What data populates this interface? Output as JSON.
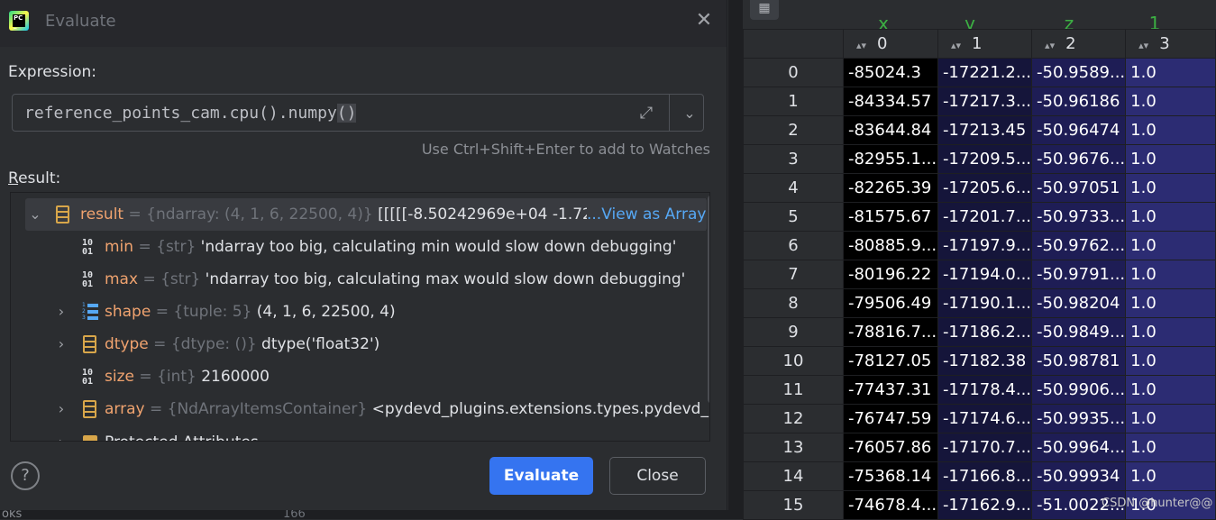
{
  "dialog": {
    "title": "Evaluate",
    "expression_label": "Expression:",
    "expression_main": "reference_points_cam.cpu().numpy",
    "expression_paren": "()",
    "hint": "Use Ctrl+Shift+Enter to add to Watches",
    "result_label_first": "R",
    "result_label_rest": "esult:",
    "evaluate_button": "Evaluate",
    "close_button": "Close",
    "help": "?"
  },
  "tree": [
    {
      "name": "result",
      "eq": " = ",
      "type": "{ndarray: (4, 1, 6, 22500, 4)}",
      "value": " [[[[[-8.50242969e+04 -1.722",
      "link": "...View as Array",
      "icon": "array-icon",
      "expandable": true,
      "expanded": true
    },
    {
      "name": "min",
      "eq": " = ",
      "type": "{str}",
      "value": " 'ndarray too big, calculating min would slow down debugging'",
      "icon": "binary-icon"
    },
    {
      "name": "max",
      "eq": " = ",
      "type": "{str}",
      "value": " 'ndarray too big, calculating max would slow down debugging'",
      "icon": "binary-icon"
    },
    {
      "name": "shape",
      "eq": " = ",
      "type": "{tuple: 5}",
      "value": " (4, 1, 6, 22500, 4)",
      "icon": "list-icon",
      "expandable": true
    },
    {
      "name": "dtype",
      "eq": " = ",
      "type": "{dtype: ()}",
      "value": " dtype('float32')",
      "icon": "array-icon",
      "expandable": true
    },
    {
      "name": "size",
      "eq": " = ",
      "type": "{int}",
      "value": " 2160000",
      "icon": "binary-icon"
    },
    {
      "name": "array",
      "eq": " = ",
      "type": "{NdArrayItemsContainer}",
      "value": " <pydevd_plugins.extensions.types.pydevd_",
      "icon": "array-icon",
      "expandable": true
    },
    {
      "name": "Protected Attributes",
      "eq": "",
      "type": "",
      "value": "",
      "icon": "folder-icon",
      "expandable": true
    }
  ],
  "bottom_strip": {
    "left_text": "oks",
    "mid_text": "166"
  },
  "data_view": {
    "axis_labels": [
      "x",
      "y",
      "z",
      "1"
    ],
    "columns": [
      "0",
      "1",
      "2",
      "3"
    ],
    "rows": [
      [
        "0",
        "-85024.3",
        "-17221.2...",
        "-50.9589...",
        "1.0"
      ],
      [
        "1",
        "-84334.57",
        "-17217.3...",
        "-50.96186",
        "1.0"
      ],
      [
        "2",
        "-83644.84",
        "-17213.45",
        "-50.96474",
        "1.0"
      ],
      [
        "3",
        "-82955.1...",
        "-17209.5...",
        "-50.9676...",
        "1.0"
      ],
      [
        "4",
        "-82265.39",
        "-17205.6...",
        "-50.97051",
        "1.0"
      ],
      [
        "5",
        "-81575.67",
        "-17201.7...",
        "-50.9733...",
        "1.0"
      ],
      [
        "6",
        "-80885.9...",
        "-17197.9...",
        "-50.9762...",
        "1.0"
      ],
      [
        "7",
        "-80196.22",
        "-17194.0...",
        "-50.9791...",
        "1.0"
      ],
      [
        "8",
        "-79506.49",
        "-17190.1...",
        "-50.98204",
        "1.0"
      ],
      [
        "9",
        "-78816.7...",
        "-17186.2...",
        "-50.9849...",
        "1.0"
      ],
      [
        "10",
        "-78127.05",
        "-17182.38",
        "-50.98781",
        "1.0"
      ],
      [
        "11",
        "-77437.31",
        "-17178.4...",
        "-50.9906...",
        "1.0"
      ],
      [
        "12",
        "-76747.59",
        "-17174.6...",
        "-50.9935...",
        "1.0"
      ],
      [
        "13",
        "-76057.86",
        "-17170.7...",
        "-50.9964...",
        "1.0"
      ],
      [
        "14",
        "-75368.14",
        "-17166.8...",
        "-50.99934",
        "1.0"
      ],
      [
        "15",
        "-74678.4...",
        "-17162.9...",
        "-51.0022...",
        "1.0"
      ]
    ],
    "watermark": "CSDN @hunter@@"
  }
}
